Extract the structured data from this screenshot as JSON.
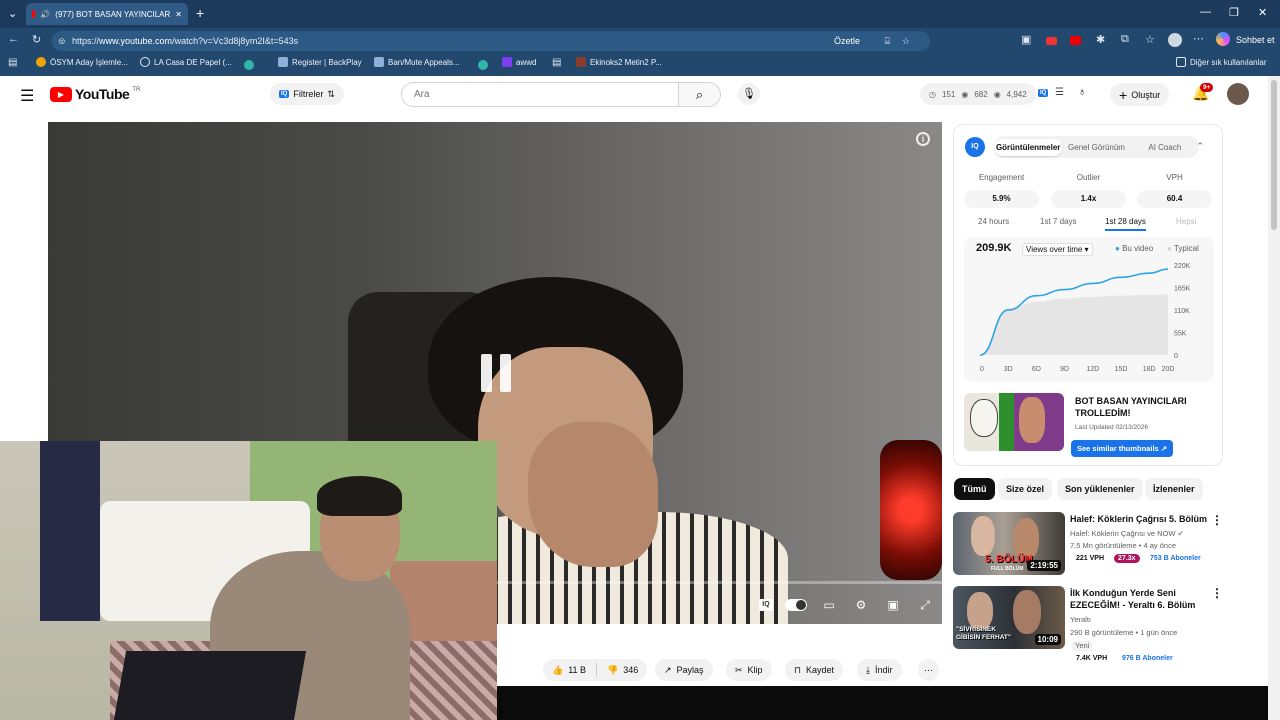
{
  "browser": {
    "tab_title": "(977) BOT BASAN YAYINCILAR",
    "url_prefix": "https://",
    "url_host": "www.youtube.com",
    "url_path": "/watch?v=Vc3d8j8ym2I&t=543s",
    "ozetle": "Özetle",
    "sohbet": "Sohbet et",
    "bookmarks": [
      "ÖSYM Aday İşlemle...",
      "LA Casa DE Papel (...",
      "Register | BackPlay",
      "Ban/Mute Appeals...",
      "awwd",
      "Ekinoks2 Metin2 P..."
    ],
    "other_bookmarks": "Diğer sık kullanılanlar"
  },
  "header": {
    "logo_text": "YouTube",
    "logo_sup": "TR",
    "filters": "Filtreler",
    "search_placeholder": "Ara",
    "stats": [
      "151",
      "682",
      "4,942"
    ],
    "create": "Oluştur",
    "notif": "9+"
  },
  "player": {
    "camera_overlay": true
  },
  "actions": {
    "likes": "11 B",
    "dislikes": "346",
    "share": "Paylaş",
    "clip": "Klip",
    "save": "Kaydet",
    "download": "İndir"
  },
  "panel": {
    "tabs": [
      "Görüntülenmeler",
      "Genel Görünüm",
      "AI Coach"
    ],
    "metrics": [
      {
        "label": "Engagement",
        "value": "5.9%"
      },
      {
        "label": "Outlier",
        "value": "1.4x"
      },
      {
        "label": "VPH",
        "value": "60.4"
      }
    ],
    "ranges": [
      "24 hours",
      "1st 7 days",
      "1st 28 days",
      "Hepsi"
    ],
    "total_views": "209.9K",
    "views_select": "Views over time",
    "legend_this": "Bu video",
    "legend_typical": "Typical",
    "thumb_title": "BOT BASAN YAYINCILARI TROLLEDİM!",
    "last_updated": "Last Updated 02/13/2026",
    "similar_btn": "See similar thumbnails"
  },
  "chart_data": {
    "type": "line",
    "x": [
      0,
      3,
      6,
      9,
      12,
      15,
      18,
      20
    ],
    "x_tick_labels": [
      "0",
      "3D",
      "6D",
      "9D",
      "12D",
      "15D",
      "18D",
      "20D"
    ],
    "y_tick_labels": [
      "220K",
      "165K",
      "110K",
      "55K",
      "0"
    ],
    "ylim": [
      0,
      220000
    ],
    "series": [
      {
        "name": "Bu video",
        "values": [
          0,
          110000,
          145000,
          160000,
          175000,
          190000,
          200000,
          209900
        ]
      },
      {
        "name": "Typical",
        "values": [
          0,
          115000,
          130000,
          138000,
          142000,
          145000,
          147000,
          148000
        ]
      }
    ],
    "colors": {
      "this": "#2aa4e6",
      "typical": "#d9d9d9"
    }
  },
  "chips": [
    "Tümü",
    "Size özel",
    "Son yüklenenler",
    "İzlenenler"
  ],
  "videos": [
    {
      "title": "Halef: Köklerin Çağrısı 5. Bölüm",
      "channel": "Halef: Köklerin Çağrısı ve NOW",
      "meta": "7,5 Mn görüntüleme • 4 ay önce",
      "duration": "2:19:55",
      "vph": "221 VPH",
      "outlier": "27.3x",
      "subs": "753 B Aboneler",
      "thumb_caption": "5. BÖLÜM",
      "thumb_subcaption": "FULL BÖLÜM"
    },
    {
      "title": "İlk Konduğun Yerde Seni EZECEĞİM! - Yeraltı 6. Bölüm",
      "channel": "Yeraltı",
      "meta": "290 B görüntüleme • 1 gün önce",
      "new": "Yeni",
      "duration": "10:09",
      "vph": "7.4K VPH",
      "subs": "976 B Aboneler",
      "thumb_caption": "\"SİVRİSİNEK GİBİSİN FERHAT\""
    }
  ]
}
